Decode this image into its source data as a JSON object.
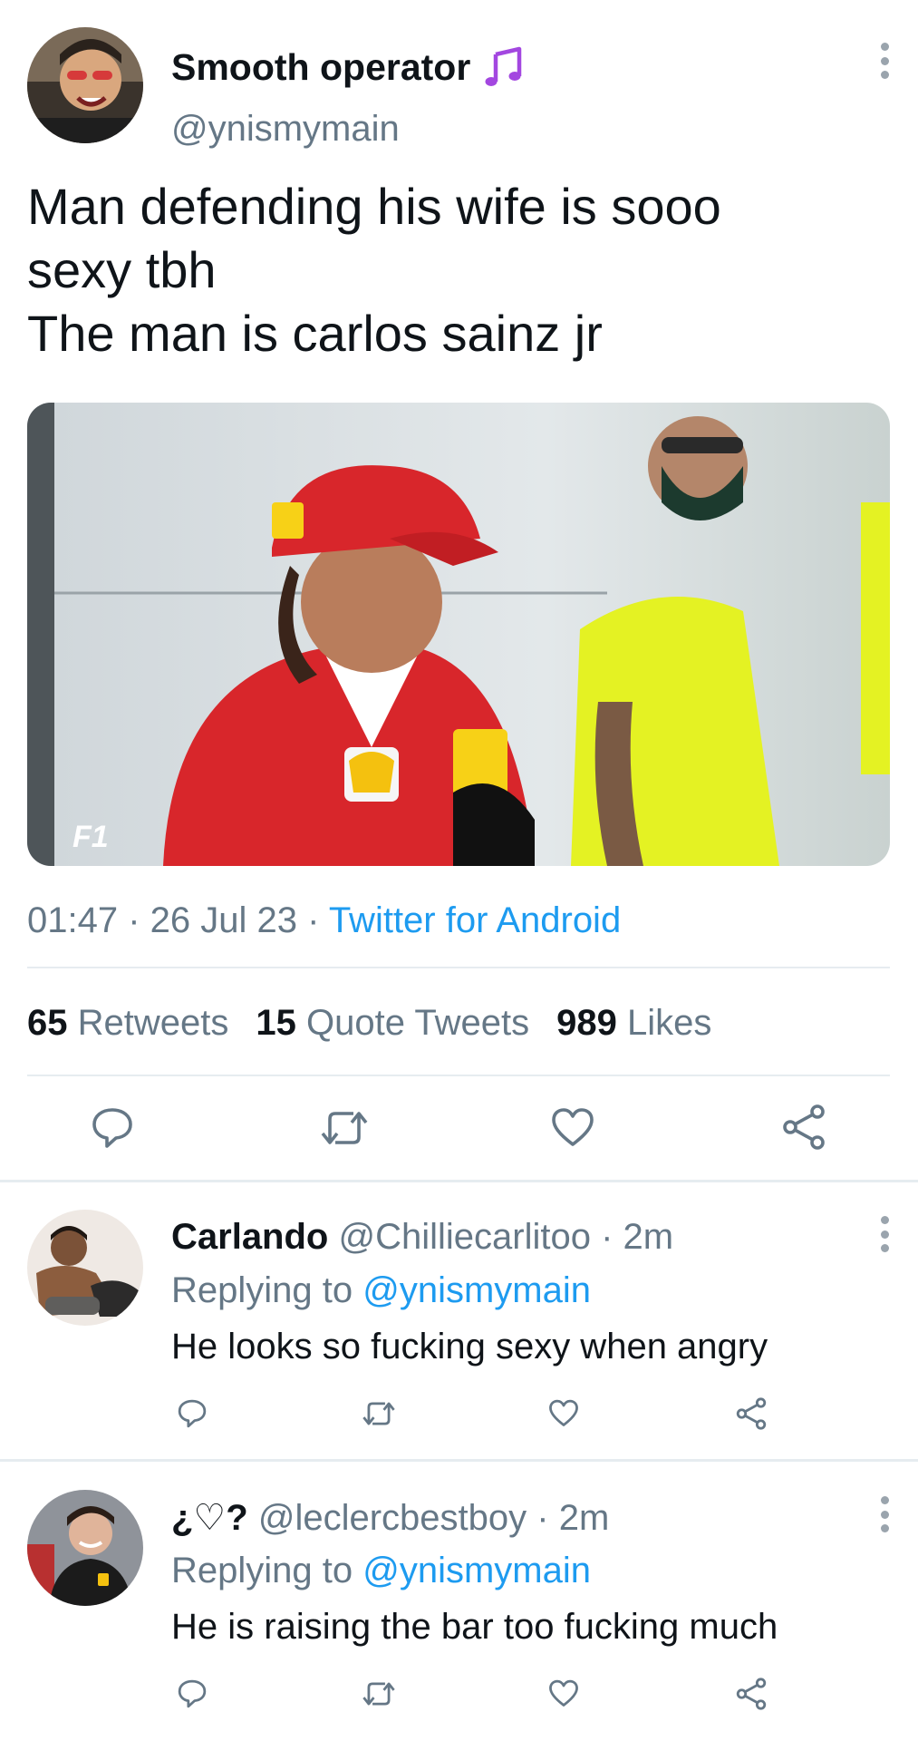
{
  "main_tweet": {
    "display_name": "Smooth operator",
    "name_emoji": "♫",
    "handle": "@ynismymain",
    "text_lines": [
      "Man defending his wife is sooo",
      "sexy tbh",
      "The man is carlos sainz jr"
    ],
    "time": "01:47",
    "date": "26 Jul 23",
    "source": "Twitter for Android",
    "separator": " · ",
    "stats": {
      "retweets_count": "65",
      "retweets_label": "Retweets",
      "quotes_count": "15",
      "quotes_label": "Quote Tweets",
      "likes_count": "989",
      "likes_label": "Likes"
    },
    "media_logo_text": "F1",
    "icons": {
      "reply": "reply-icon",
      "retweet": "retweet-icon",
      "like": "heart-icon",
      "share": "share-icon",
      "more": "more-vertical-icon"
    }
  },
  "replies": [
    {
      "display_name": "Carlando",
      "handle": "@Chilliecarlitoo",
      "time": "2m",
      "replying_prefix": "Replying to",
      "replying_to": "@ynismymain",
      "text": "He looks so fucking sexy when angry"
    },
    {
      "display_name": "¿♡?",
      "handle": "@leclercbestboy",
      "time": "2m",
      "replying_prefix": "Replying to",
      "replying_to": "@ynismymain",
      "text": "He is raising the bar too fucking much"
    }
  ],
  "colors": {
    "link_blue": "#1d9bf0",
    "secondary_text": "#657786",
    "music_note": "#a347e0"
  }
}
